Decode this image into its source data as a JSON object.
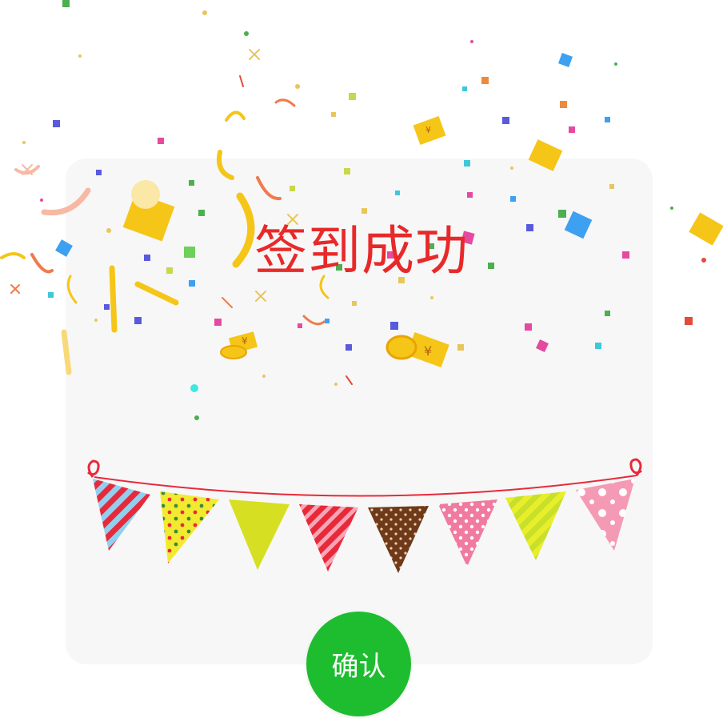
{
  "dialog": {
    "title": "签到成功",
    "confirm_label": "确认"
  },
  "colors": {
    "title": "#e8292a",
    "confirm_button": "#1dbd2f",
    "card_background": "#f7f7f7"
  },
  "decorations": {
    "coin_symbol": "¥"
  }
}
